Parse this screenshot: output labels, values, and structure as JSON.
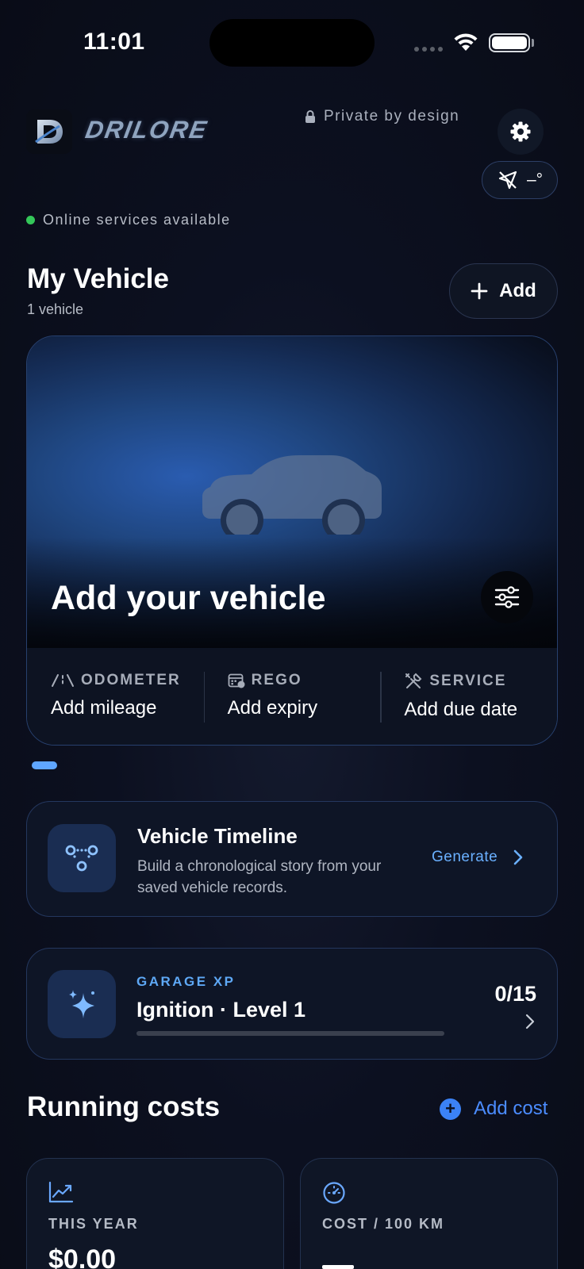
{
  "status_bar": {
    "time": "11:01"
  },
  "header": {
    "brand": "DRILORE",
    "privacy_text": "Private by design",
    "gps_reading": "–°",
    "online_status": "Online services available"
  },
  "my_vehicle": {
    "title": "My Vehicle",
    "count_text": "1 vehicle",
    "add_label": "Add",
    "card": {
      "title": "Add your vehicle",
      "stats": [
        {
          "label": "ODOMETER",
          "value": "Add mileage",
          "icon": "odometer-icon"
        },
        {
          "label": "REGO",
          "value": "Add expiry",
          "icon": "calendar-icon"
        },
        {
          "label": "SERVICE",
          "value": "Add due date",
          "icon": "wrench-icon"
        }
      ]
    }
  },
  "timeline": {
    "title": "Vehicle Timeline",
    "description": "Build a chronological story from your saved vehicle records.",
    "action": "Generate"
  },
  "garage_xp": {
    "label": "GARAGE XP",
    "level_text": "Ignition · Level 1",
    "progress": "0/15",
    "progress_fraction": 0
  },
  "running_costs": {
    "title": "Running costs",
    "add_label": "Add cost",
    "cards": [
      {
        "label": "THIS YEAR",
        "value": "$0.00",
        "icon": "trend-chart-icon"
      },
      {
        "label": "COST / 100 KM",
        "value": "",
        "icon": "speedometer-icon"
      }
    ]
  },
  "colors": {
    "accent": "#5ea8f5",
    "link": "#4b8cff",
    "online": "#34c759",
    "card_border": "#24375e"
  }
}
